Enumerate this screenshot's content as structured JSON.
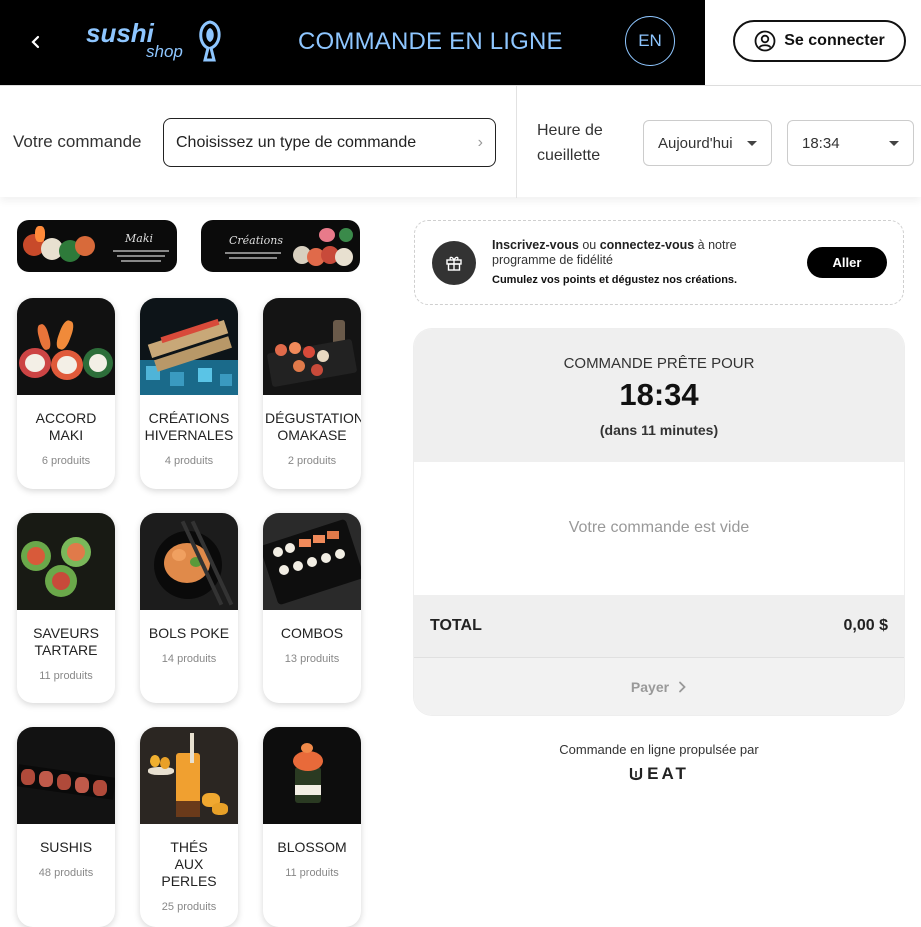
{
  "header": {
    "back_icon": "chevron-left-icon",
    "logo_word_1": "sushi",
    "logo_word_2": "shop",
    "title": "COMMANDE EN LIGNE",
    "lang": "EN",
    "login_label": "Se connecter",
    "login_icon": "user-circle-icon"
  },
  "order_bar": {
    "order_label": "Votre commande",
    "order_type_placeholder": "Choisissez un type de commande",
    "pickup_label": "Heure de cueillette",
    "day_value": "Aujourd'hui",
    "time_value": "18:34"
  },
  "categories": [
    {
      "name": "ACCORD MAKI",
      "count": "6 produits"
    },
    {
      "name": "CRÉATIONS HIVERNALES",
      "count": "4 produits"
    },
    {
      "name": "DÉGUSTATION OMAKASE",
      "count": "2 produits"
    },
    {
      "name": "SAVEURS TARTARE",
      "count": "11 produits"
    },
    {
      "name": "BOLS POKE",
      "count": "14 produits"
    },
    {
      "name": "COMBOS",
      "count": "13 produits"
    },
    {
      "name": "SUSHIS",
      "count": "48 produits"
    },
    {
      "name": "THÉS AUX PERLES",
      "count": "25 produits"
    },
    {
      "name": "BLOSSOM",
      "count": "11 produits"
    }
  ],
  "loyalty": {
    "signup": "Inscrivez-vous",
    "or": " ou ",
    "connect": "connectez-vous",
    "rest": " à notre programme de fidélité",
    "sub": "Cumulez vos points et dégustez nos créations.",
    "button": "Aller",
    "icon": "gift-icon"
  },
  "cart": {
    "ready_label": "COMMANDE PRÊTE POUR",
    "ready_time": "18:34",
    "ready_minutes": "(dans 11 minutes)",
    "empty_message": "Votre commande est vide",
    "total_label": "TOTAL",
    "total_value": "0,00 $",
    "pay_label": "Payer"
  },
  "footer": {
    "powered_by": "Commande en ligne propulsée par",
    "brand": "EAT"
  },
  "colors": {
    "accent": "#8ec6ff",
    "header_bg": "#000000",
    "cart_bg": "#efefef"
  }
}
